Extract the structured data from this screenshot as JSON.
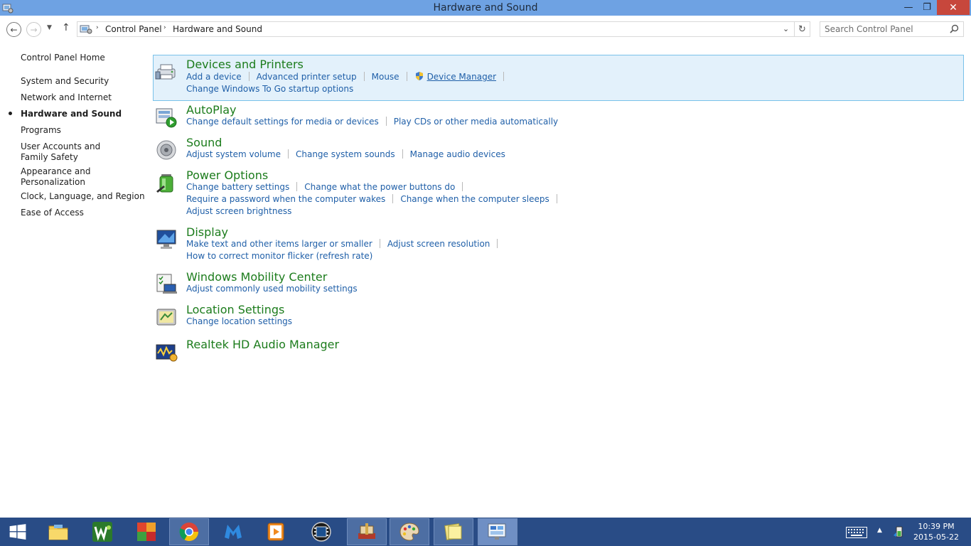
{
  "window": {
    "title": "Hardware and Sound",
    "minimize_glyph": "—",
    "maximize_glyph": "❐",
    "close_glyph": "✕"
  },
  "nav": {
    "back_glyph": "←",
    "forward_glyph": "→",
    "recent_glyph": "▼",
    "up_glyph": "↑",
    "breadcrumb": [
      "Control Panel",
      "Hardware and Sound"
    ],
    "breadcrumb_sep": "›",
    "dropdown_glyph": "⌄",
    "refresh_glyph": "↻",
    "search_placeholder": "Search Control Panel"
  },
  "sidebar": {
    "home": "Control Panel Home",
    "items": [
      "System and Security",
      "Network and Internet",
      "Hardware and Sound",
      "Programs",
      "User Accounts and Family Safety",
      "Appearance and Personalization",
      "Clock, Language, and Region",
      "Ease of Access"
    ],
    "active_item": "Hardware and Sound"
  },
  "categories": {
    "devices": {
      "title": "Devices and Printers",
      "links": [
        "Add a device",
        "Advanced printer setup",
        "Mouse",
        "Device Manager",
        "Change Windows To Go startup options"
      ]
    },
    "autoplay": {
      "title": "AutoPlay",
      "links": [
        "Change default settings for media or devices",
        "Play CDs or other media automatically"
      ]
    },
    "sound": {
      "title": "Sound",
      "links": [
        "Adjust system volume",
        "Change system sounds",
        "Manage audio devices"
      ]
    },
    "power": {
      "title": "Power Options",
      "links": [
        "Change battery settings",
        "Change what the power buttons do",
        "Require a password when the computer wakes",
        "Change when the computer sleeps",
        "Adjust screen brightness"
      ]
    },
    "display": {
      "title": "Display",
      "links": [
        "Make text and other items larger or smaller",
        "Adjust screen resolution",
        "How to correct monitor flicker (refresh rate)"
      ]
    },
    "mobility": {
      "title": "Windows Mobility Center",
      "links": [
        "Adjust commonly used mobility settings"
      ]
    },
    "location": {
      "title": "Location Settings",
      "links": [
        "Change location settings"
      ]
    },
    "realtek": {
      "title": "Realtek HD Audio Manager"
    }
  },
  "taskbar": {
    "time": "10:39 PM",
    "date": "2015-05-22",
    "tray_up_glyph": "▲"
  },
  "colors": {
    "titlebar": "#6ea2e3",
    "close": "#c7473c",
    "category_title": "#1c7c1c",
    "link": "#1f5fa8",
    "highlight_bg": "#e3f1fb",
    "highlight_border": "#79c2ea",
    "taskbar": "#294c86"
  }
}
